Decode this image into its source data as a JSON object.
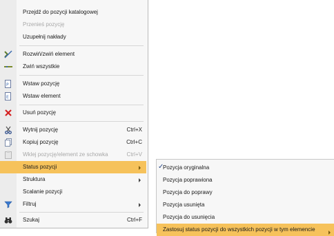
{
  "menu": {
    "items": [
      {
        "label": "Przejdź do pozycji katalogowej",
        "shortcut": "",
        "disabled": false,
        "icon": ""
      },
      {
        "label": "Przenieś pozycję",
        "shortcut": "",
        "disabled": true,
        "icon": ""
      },
      {
        "label": "Uzupełnij nakłady",
        "shortcut": "",
        "disabled": false,
        "icon": ""
      },
      {
        "label": "Rozwiń/zwiń element",
        "shortcut": "",
        "disabled": false,
        "icon": "expand-collapse-icon"
      },
      {
        "label": "Zwiń wszystkie",
        "shortcut": "",
        "disabled": false,
        "icon": "collapse-all-icon"
      },
      {
        "label": "Wstaw pozycję",
        "shortcut": "",
        "disabled": false,
        "icon": "insert-position-icon"
      },
      {
        "label": "Wstaw element",
        "shortcut": "",
        "disabled": false,
        "icon": "insert-element-icon"
      },
      {
        "label": "Usuń pozycję",
        "shortcut": "",
        "disabled": false,
        "icon": "delete-x-icon"
      },
      {
        "label": "Wytnij pozycję",
        "shortcut": "Ctrl+X",
        "disabled": false,
        "icon": "scissors-icon"
      },
      {
        "label": "Kopiuj pozycję",
        "shortcut": "Ctrl+C",
        "disabled": false,
        "icon": "copy-icon"
      },
      {
        "label": "Wklej pozycję/element ze schowka",
        "shortcut": "Ctrl+V",
        "disabled": true,
        "icon": "paste-icon"
      },
      {
        "label": "Status pozycji",
        "shortcut": "",
        "disabled": false,
        "icon": "",
        "submenu": true,
        "highlight": true
      },
      {
        "label": "Struktura",
        "shortcut": "",
        "disabled": false,
        "icon": "",
        "submenu": true
      },
      {
        "label": "Scalanie pozycji",
        "shortcut": "",
        "disabled": false,
        "icon": ""
      },
      {
        "label": "Filtruj",
        "shortcut": "",
        "disabled": false,
        "icon": "filter-funnel-icon",
        "submenu": true
      },
      {
        "label": "Szukaj",
        "shortcut": "Ctrl+F",
        "disabled": false,
        "icon": "binoculars-icon"
      }
    ]
  },
  "submenu": {
    "items": [
      {
        "label": "Pozycja oryginalna",
        "checked": true
      },
      {
        "label": "Pozycja poprawiona",
        "checked": false
      },
      {
        "label": "Pozycja do poprawy",
        "checked": false
      },
      {
        "label": "Pozycja usunięta",
        "checked": false
      },
      {
        "label": "Pozycja do usunięcia",
        "checked": false
      },
      {
        "label": "Zastosuj status pozycji do wszystkich pozycji w tym elemencie",
        "checked": false,
        "highlight": true,
        "submenu": true
      }
    ]
  },
  "colors": {
    "highlight": "#f6c25b",
    "menu_bg": "#f7f7f7",
    "disabled_text": "#a8a8a8",
    "delete_red": "#d42020"
  }
}
